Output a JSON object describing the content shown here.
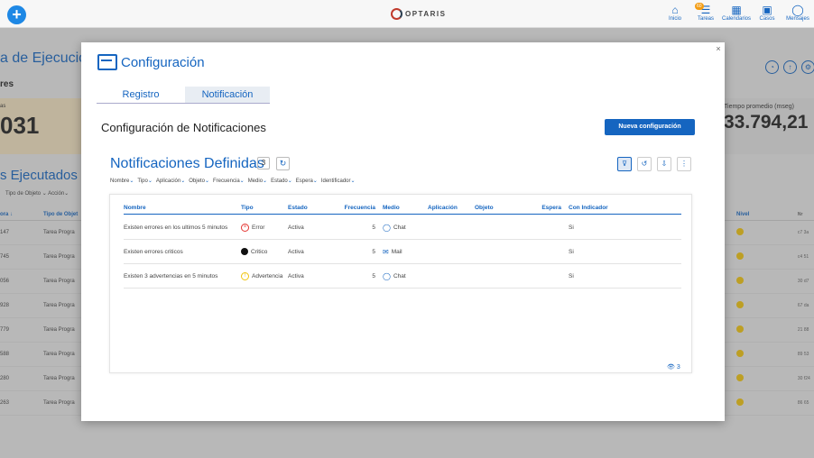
{
  "topbar": {
    "add_icon": "plus-icon",
    "logo_text": "OPTARIS",
    "nav": [
      {
        "label": "Inicio",
        "icon": "home-icon",
        "glyph": "⌂"
      },
      {
        "label": "Tareas",
        "icon": "tasks-icon",
        "glyph": "☰",
        "badge": "60"
      },
      {
        "label": "Calendarios",
        "icon": "calendar-icon",
        "glyph": "▦"
      },
      {
        "label": "Casos",
        "icon": "briefcase-icon",
        "glyph": "▣"
      },
      {
        "label": "Mensajes",
        "icon": "chat-icon",
        "glyph": "◯"
      }
    ]
  },
  "background": {
    "title": "a de Ejecución",
    "sub": "res",
    "card_label": "as",
    "card_value": "031",
    "right_card_label": "Tiempo promedio (mseg)",
    "right_card_value": "33.794,21",
    "section_title": "s Ejecutados",
    "filters": "Tipo de Objeto ⌄  Acción⌄",
    "table_headers": [
      "ora ↓",
      "Tipo de Objet"
    ],
    "rows": [
      {
        "a": "147",
        "b": "Tarea Progra"
      },
      {
        "a": "745",
        "b": "Tarea Progra"
      },
      {
        "a": "056",
        "b": "Tarea Progra"
      },
      {
        "a": "928",
        "b": "Tarea Progra"
      },
      {
        "a": "779",
        "b": "Tarea Progra"
      },
      {
        "a": "588",
        "b": "Tarea Progra"
      },
      {
        "a": "280",
        "b": "Tarea Progra"
      },
      {
        "a": "263",
        "b": "Tarea Progra"
      }
    ],
    "right_headers": [
      "Nivel",
      "Nr"
    ],
    "right_rows": [
      {
        "id": "c7 3a"
      },
      {
        "id": "c4 51"
      },
      {
        "id": "30 d7"
      },
      {
        "id": "67 da"
      },
      {
        "id": "21 88"
      },
      {
        "id": "89 53"
      },
      {
        "id": "30 f24"
      },
      {
        "id": "86 65"
      }
    ]
  },
  "modal": {
    "title": "Configuración",
    "close": "×",
    "tabs": [
      "Registro",
      "Notificación"
    ],
    "subtitle": "Configuración de Notificaciones",
    "new_button": "Nueva configuración",
    "section_title": "Notificaciones Definidas",
    "count": "3",
    "filters": [
      "Nombre",
      "Tipo",
      "Aplicación",
      "Objeto",
      "Frecuencia",
      "Medio",
      "Estado",
      "Espera",
      "Identificador"
    ],
    "columns": {
      "nombre": "Nombre",
      "tipo": "Tipo",
      "estado": "Estado",
      "frecuencia": "Frecuencia",
      "medio": "Medio",
      "aplicacion": "Aplicación",
      "objeto": "Objeto",
      "espera": "Espera",
      "indicador": "Con Indicador"
    },
    "rows": [
      {
        "nombre": "Existen errores en los ultimos 5 minutos",
        "tipo": "Error",
        "tipo_icon": "error-icon",
        "estado": "Activa",
        "frecuencia": "5",
        "medio": "Chat",
        "medio_icon": "chat-icon",
        "aplicacion": "",
        "objeto": "",
        "espera": "",
        "indicador": "Si"
      },
      {
        "nombre": "Existen errores criticos",
        "tipo": "Critico",
        "tipo_icon": "critical-icon",
        "estado": "Activa",
        "frecuencia": "5",
        "medio": "Mail",
        "medio_icon": "mail-icon",
        "aplicacion": "",
        "objeto": "",
        "espera": "",
        "indicador": "Si"
      },
      {
        "nombre": "Existen 3 advertencias en 5 minutos",
        "tipo": "Advertencia",
        "tipo_icon": "warning-icon",
        "estado": "Activa",
        "frecuencia": "5",
        "medio": "Chat",
        "medio_icon": "chat-icon",
        "aplicacion": "",
        "objeto": "",
        "espera": "",
        "indicador": "Si"
      }
    ],
    "viewers": "3"
  }
}
